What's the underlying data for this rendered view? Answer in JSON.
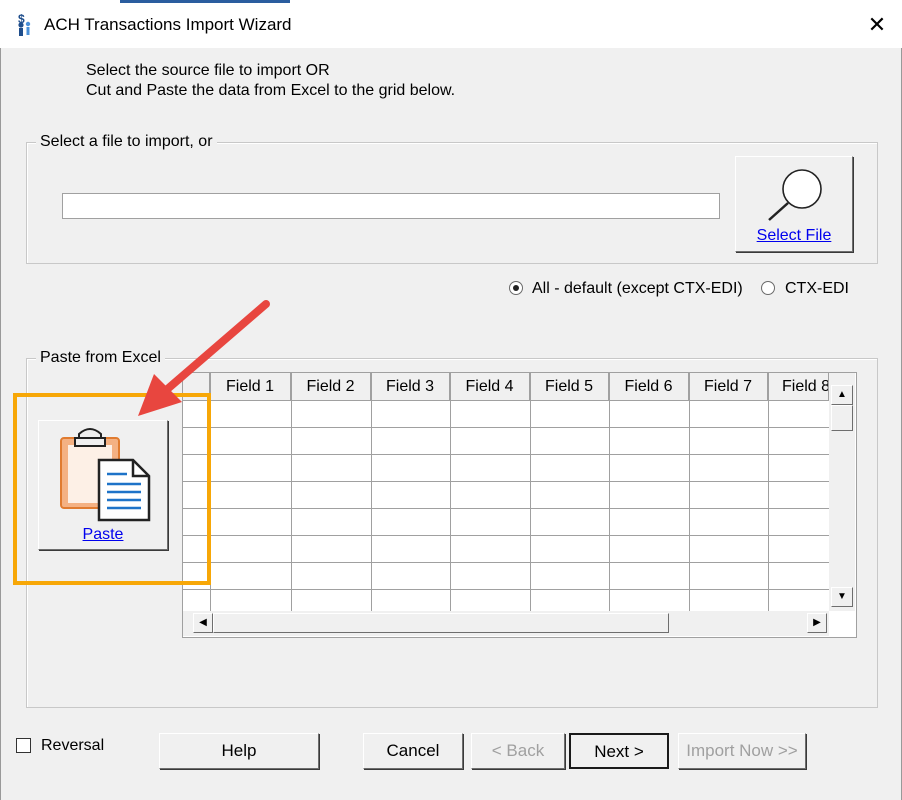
{
  "window": {
    "title": "ACH Transactions Import Wizard",
    "close_glyph": "✕"
  },
  "instructions": {
    "line1": "Select the source file to import OR",
    "line2": "Cut and Paste the data from Excel to the grid below."
  },
  "file_group": {
    "legend": "Select a file to import, or",
    "path_value": "",
    "select_file_label": "Select File",
    "select_file_icon": "magnifier-icon"
  },
  "format_options": {
    "options": [
      {
        "label": "All - default (except CTX-EDI)",
        "selected": true
      },
      {
        "label": "CTX-EDI",
        "selected": false
      }
    ]
  },
  "paste_group": {
    "legend": "Paste from Excel",
    "paste_label": "Paste",
    "paste_icon": "clipboard-icon"
  },
  "grid": {
    "columns": [
      "Field 1",
      "Field 2",
      "Field 3",
      "Field 4",
      "Field 5",
      "Field 6",
      "Field 7",
      "Field 8"
    ],
    "rows": [
      [],
      [],
      [],
      [],
      [],
      [],
      [],
      []
    ]
  },
  "footer": {
    "reversal_label": "Reversal",
    "reversal_checked": false,
    "help_label": "Help",
    "cancel_label": "Cancel",
    "back_label": "< Back",
    "next_label": "Next >",
    "import_now_label": "Import Now >>"
  },
  "colors": {
    "highlight": "#f7a707",
    "annotation_arrow": "#e8463f",
    "link": "#0000ee"
  }
}
